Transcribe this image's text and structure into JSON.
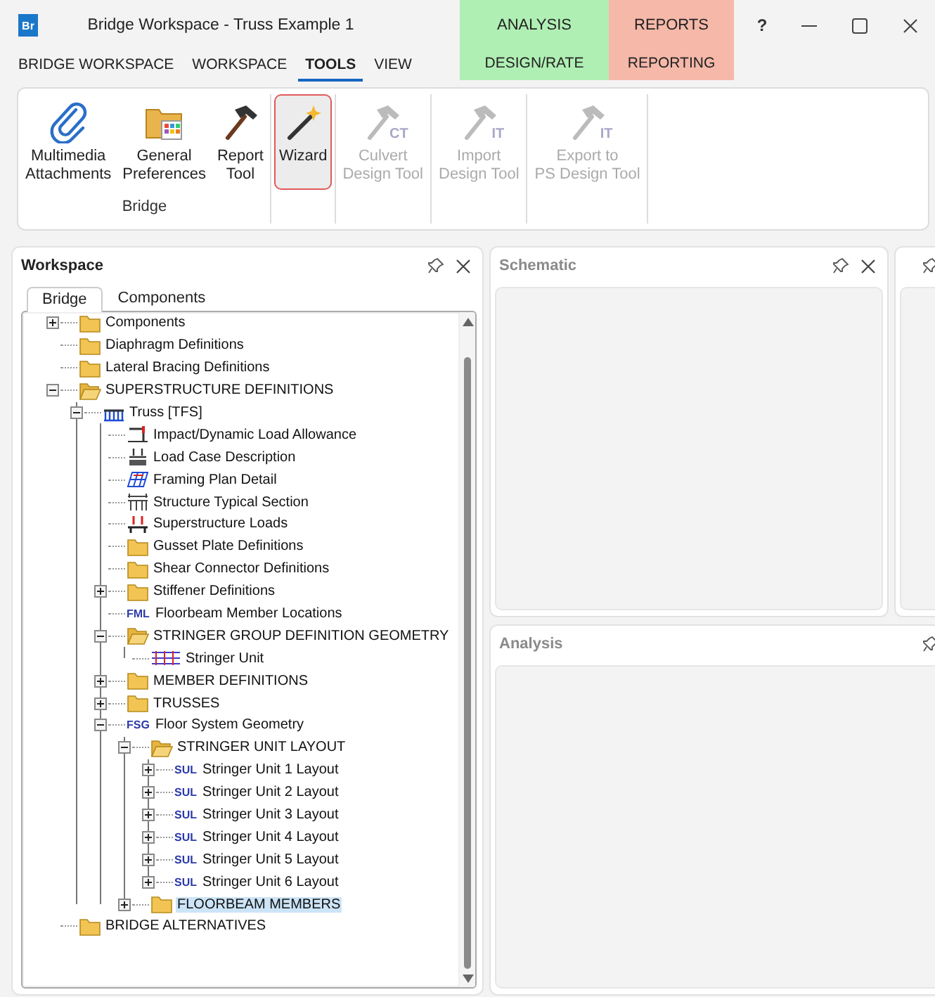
{
  "title_bar": {
    "app_icon_text": "Br",
    "title": "Bridge Workspace - Truss Example 1",
    "help": "?"
  },
  "menu_tabs": [
    {
      "label": "BRIDGE WORKSPACE",
      "selected": false
    },
    {
      "label": "WORKSPACE",
      "selected": false
    },
    {
      "label": "TOOLS",
      "selected": true
    },
    {
      "label": "VIEW",
      "selected": false
    }
  ],
  "context_groups": [
    {
      "label": "ANALYSIS",
      "color": "#b0efb4",
      "tab": {
        "label": "DESIGN/RATE",
        "selected": false
      }
    },
    {
      "label": "REPORTS",
      "color": "#f5b8a9",
      "tab": {
        "label": "REPORTING",
        "selected": false
      }
    }
  ],
  "ribbon": {
    "groups": [
      {
        "label": "Bridge",
        "buttons": [
          {
            "label": "Multimedia\nAttachments",
            "kind": "paperclip",
            "disabled": false,
            "highlighted": false
          },
          {
            "label": "General\nPreferences",
            "kind": "preferences",
            "disabled": false,
            "highlighted": false
          },
          {
            "label": "Report\nTool",
            "kind": "hammer",
            "disabled": false,
            "highlighted": false
          }
        ]
      },
      {
        "buttons": [
          {
            "label": "Wizard",
            "kind": "wand",
            "disabled": false,
            "highlighted": true
          }
        ]
      },
      {
        "buttons": [
          {
            "label": "Culvert\nDesign Tool",
            "kind": "hammer",
            "badge": "CT",
            "disabled": true,
            "highlighted": false
          }
        ]
      },
      {
        "buttons": [
          {
            "label": "Import\nDesign Tool",
            "kind": "hammer",
            "badge": "IT",
            "disabled": true,
            "highlighted": false
          }
        ]
      },
      {
        "buttons": [
          {
            "label": "Export to\nPS Design Tool",
            "kind": "hammer",
            "badge": "IT",
            "disabled": true,
            "highlighted": false
          }
        ]
      }
    ]
  },
  "workspace": {
    "title": "Workspace",
    "active": true,
    "tabs": [
      {
        "label": "Bridge",
        "selected": true
      },
      {
        "label": "Components",
        "selected": false
      }
    ],
    "tree": [
      {
        "label": "Components",
        "kind": "folder",
        "expanded": false,
        "selected": false
      },
      {
        "label": "Diaphragm Definitions",
        "kind": "folder",
        "selected": false
      },
      {
        "label": "Lateral Bracing Definitions",
        "kind": "folder",
        "selected": false
      },
      {
        "label": "SUPERSTRUCTURE DEFINITIONS",
        "kind": "folder-open",
        "expanded": true,
        "selected": false,
        "children": [
          {
            "label": "Truss [TFS]",
            "kind": "truss",
            "expanded": true,
            "selected": false,
            "children": [
              {
                "label": "Impact/Dynamic Load Allowance",
                "kind": "impact",
                "selected": false
              },
              {
                "label": "Load Case Description",
                "kind": "load-case",
                "selected": false
              },
              {
                "label": "Framing Plan Detail",
                "kind": "framing",
                "selected": false
              },
              {
                "label": "Structure Typical Section",
                "kind": "section",
                "selected": false
              },
              {
                "label": "Superstructure Loads",
                "kind": "loads",
                "selected": false
              },
              {
                "label": "Gusset Plate Definitions",
                "kind": "folder",
                "selected": false
              },
              {
                "label": "Shear Connector Definitions",
                "kind": "folder",
                "selected": false
              },
              {
                "label": "Stiffener Definitions",
                "kind": "folder",
                "expanded": false,
                "selected": false
              },
              {
                "label": "Floorbeam Member Locations",
                "kind": "badge",
                "badge": "FML",
                "selected": false
              },
              {
                "label": "STRINGER GROUP DEFINITION GEOMETRY",
                "kind": "folder-open",
                "expanded": true,
                "selected": false,
                "children": [
                  {
                    "label": "Stringer Unit",
                    "kind": "stringer",
                    "selected": false
                  }
                ]
              },
              {
                "label": "MEMBER DEFINITIONS",
                "kind": "folder",
                "expanded": false,
                "selected": false
              },
              {
                "label": "TRUSSES",
                "kind": "folder",
                "expanded": false,
                "selected": false
              },
              {
                "label": "Floor System Geometry",
                "kind": "badge",
                "badge": "FSG",
                "expanded": true,
                "selected": false,
                "children": [
                  {
                    "label": "STRINGER UNIT LAYOUT",
                    "kind": "folder-open",
                    "expanded": true,
                    "selected": false,
                    "children": [
                      {
                        "label": "Stringer Unit 1 Layout",
                        "kind": "badge",
                        "badge": "SUL",
                        "expanded": false,
                        "selected": false
                      },
                      {
                        "label": "Stringer Unit 2 Layout",
                        "kind": "badge",
                        "badge": "SUL",
                        "expanded": false,
                        "selected": false
                      },
                      {
                        "label": "Stringer Unit 3 Layout",
                        "kind": "badge",
                        "badge": "SUL",
                        "expanded": false,
                        "selected": false
                      },
                      {
                        "label": "Stringer Unit 4 Layout",
                        "kind": "badge",
                        "badge": "SUL",
                        "expanded": false,
                        "selected": false
                      },
                      {
                        "label": "Stringer Unit 5 Layout",
                        "kind": "badge",
                        "badge": "SUL",
                        "expanded": false,
                        "selected": false
                      },
                      {
                        "label": "Stringer Unit 6 Layout",
                        "kind": "badge",
                        "badge": "SUL",
                        "expanded": false,
                        "selected": false
                      }
                    ]
                  },
                  {
                    "label": "FLOORBEAM MEMBERS",
                    "kind": "folder",
                    "expanded": false,
                    "selected": true
                  }
                ]
              }
            ]
          }
        ]
      },
      {
        "label": "BRIDGE ALTERNATIVES",
        "kind": "folder",
        "selected": false
      }
    ]
  },
  "schematic": {
    "title": "Schematic",
    "active": false
  },
  "analysis": {
    "title": "Analysis",
    "active": false
  }
}
